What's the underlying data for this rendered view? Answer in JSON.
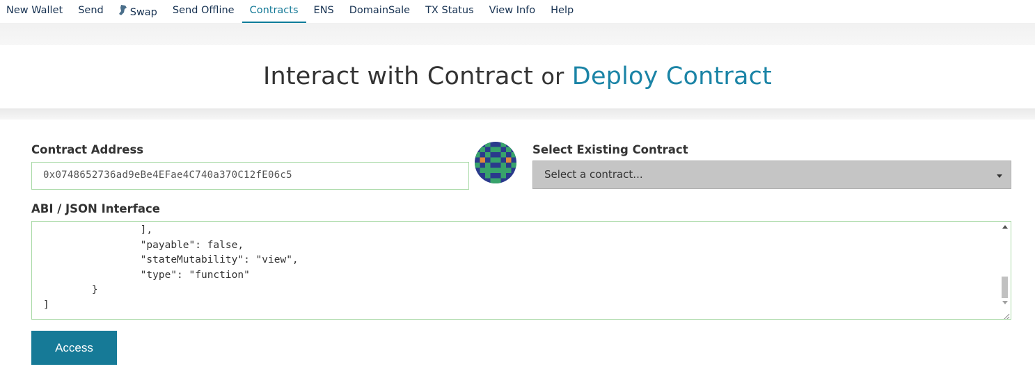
{
  "nav": {
    "items": [
      {
        "label": "New Wallet",
        "active": false
      },
      {
        "label": "Send",
        "active": false
      },
      {
        "label": "Swap",
        "active": false,
        "icon": "swap-icon"
      },
      {
        "label": "Send Offline",
        "active": false
      },
      {
        "label": "Contracts",
        "active": true
      },
      {
        "label": "ENS",
        "active": false
      },
      {
        "label": "DomainSale",
        "active": false
      },
      {
        "label": "TX Status",
        "active": false
      },
      {
        "label": "View Info",
        "active": false
      },
      {
        "label": "Help",
        "active": false
      }
    ]
  },
  "hero": {
    "title_primary": "Interact with Contract",
    "title_or": "or",
    "title_link": "Deploy Contract"
  },
  "contract_address": {
    "label": "Contract Address",
    "value": "0x0748652736ad9eBe4EFae4C740a370C12fE06c5"
  },
  "identicon": {
    "icon": "identicon-blockie"
  },
  "select_contract": {
    "label": "Select Existing Contract",
    "selected": "Select a contract..."
  },
  "abi": {
    "label": "ABI / JSON Interface",
    "visible_text": "                ],\n                \"payable\": false,\n                \"stateMutability\": \"view\",\n                \"type\": \"function\"\n        }\n]"
  },
  "access_button": {
    "label": "Access"
  },
  "colors": {
    "accent": "#167a97",
    "link": "#1b84a6",
    "input_border": "#a8d9a6",
    "select_bg": "#c5c5c5"
  }
}
